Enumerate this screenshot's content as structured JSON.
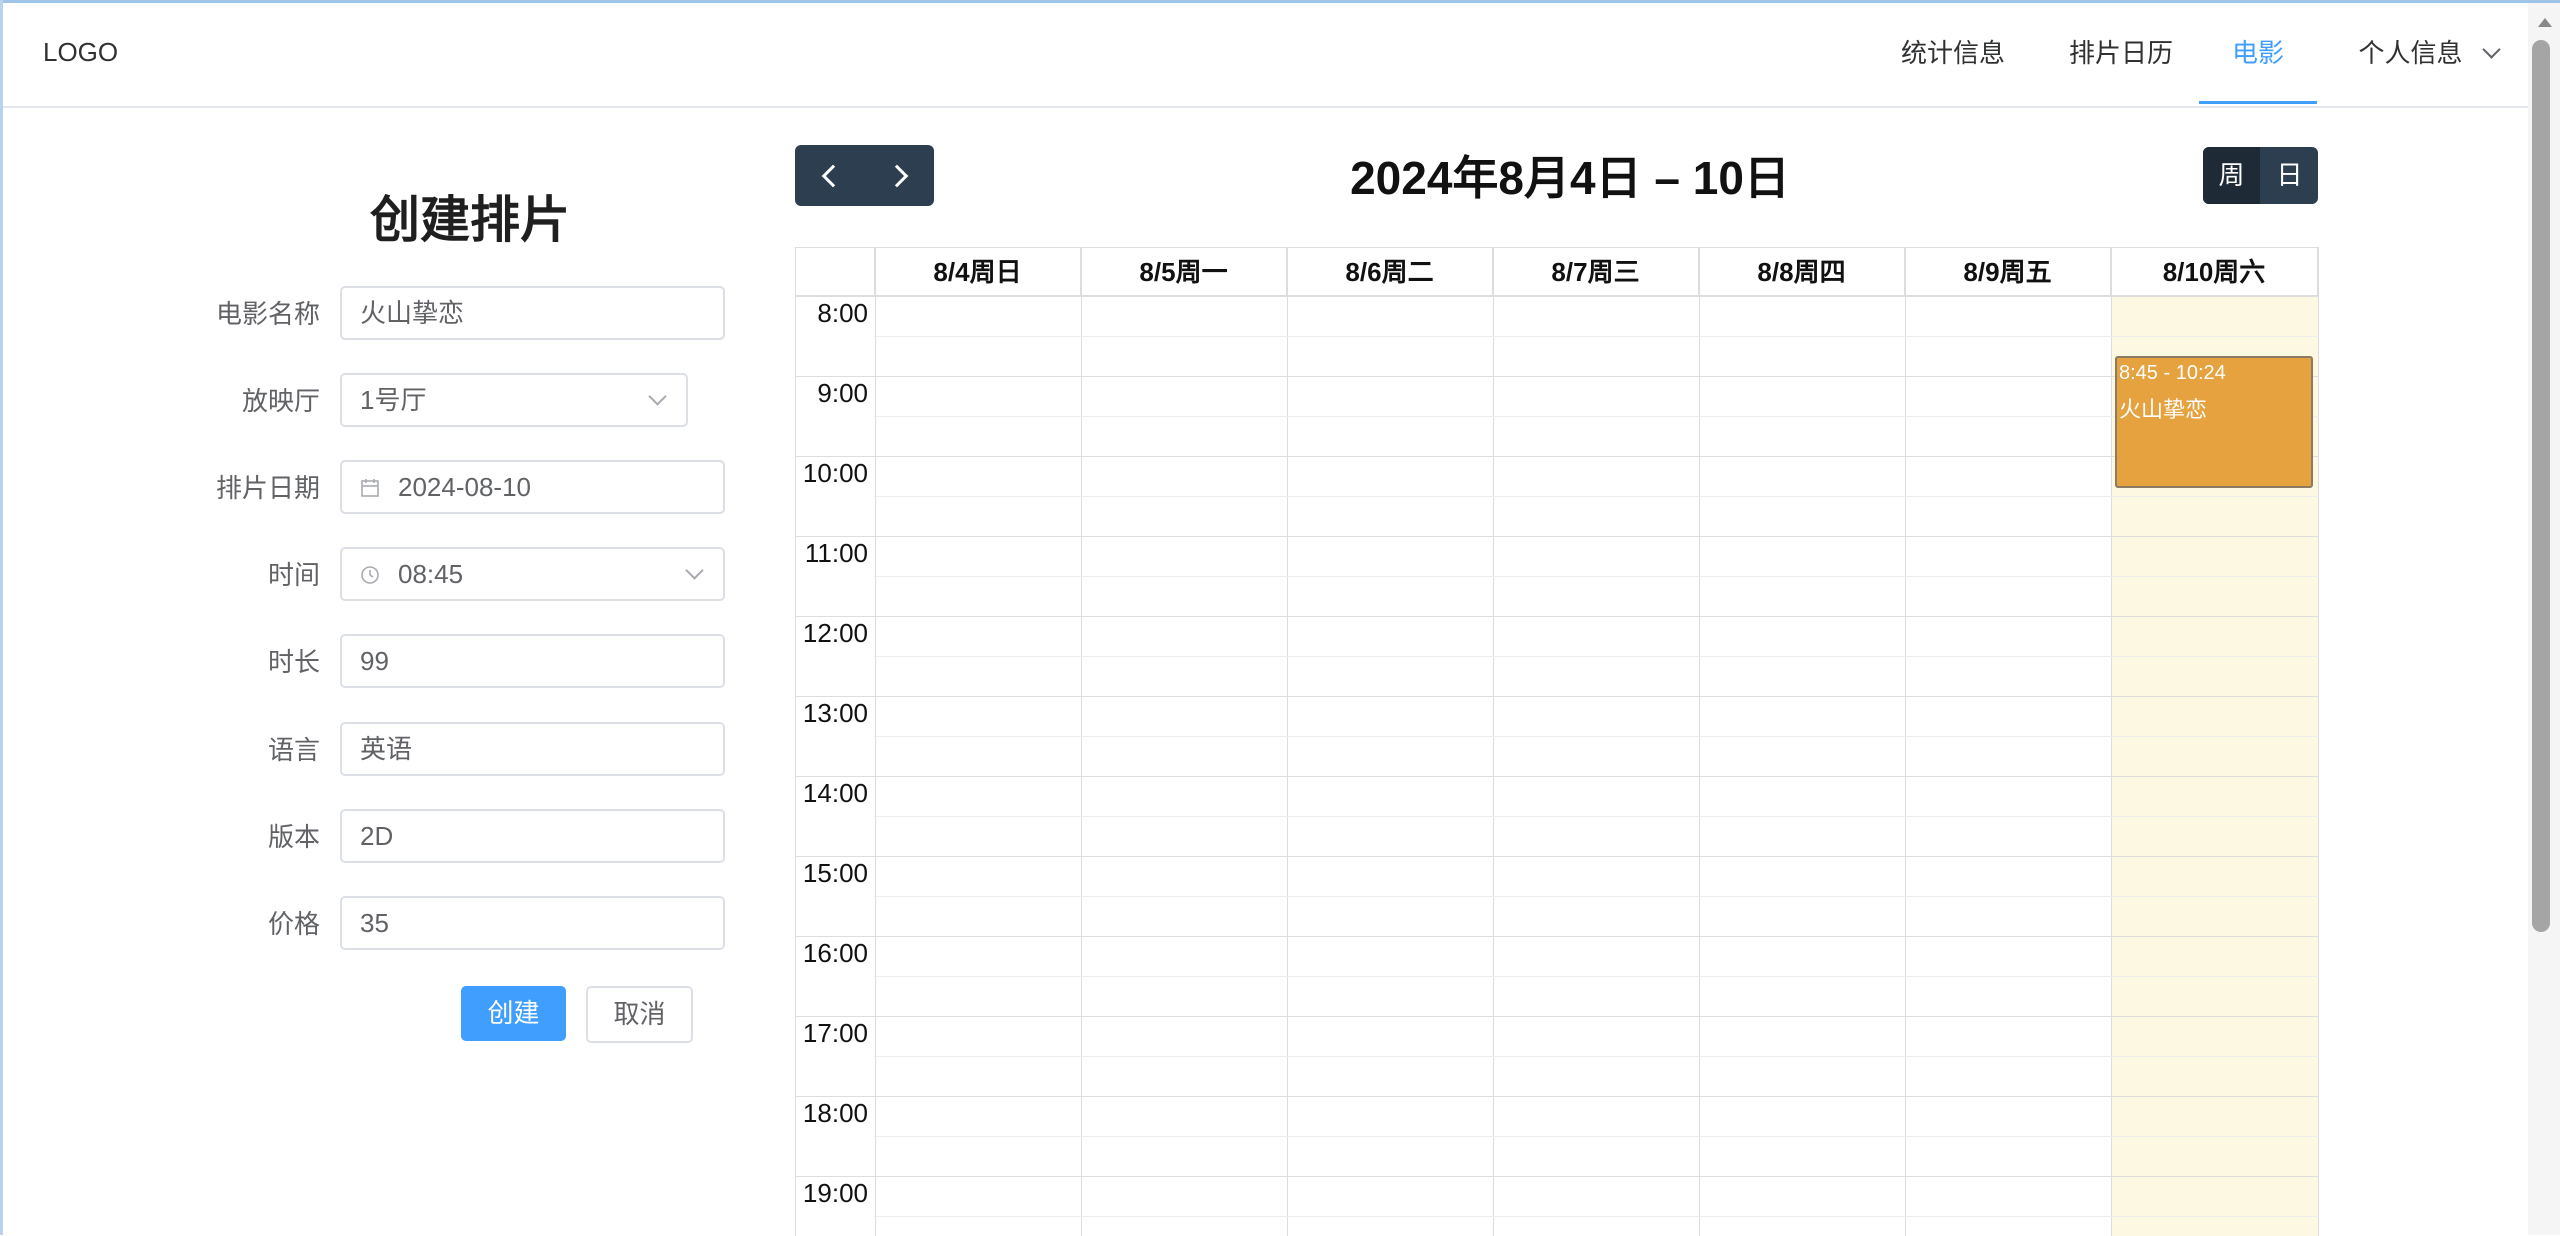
{
  "header": {
    "logo": "LOGO",
    "nav": [
      {
        "label": "统计信息",
        "active": false
      },
      {
        "label": "排片日历",
        "active": false
      },
      {
        "label": "电影",
        "active": true
      },
      {
        "label": "个人信息",
        "active": false,
        "dropdown": true
      }
    ]
  },
  "form": {
    "title": "创建排片",
    "fields": [
      {
        "label": "电影名称",
        "value": "火山挚恋",
        "type": "text"
      },
      {
        "label": "放映厅",
        "value": "1号厅",
        "type": "select"
      },
      {
        "label": "排片日期",
        "value": "2024-08-10",
        "type": "date",
        "icon": "calendar-icon"
      },
      {
        "label": "时间",
        "value": "08:45",
        "type": "time-select",
        "icon": "clock-icon"
      },
      {
        "label": "时长",
        "value": "99",
        "type": "text"
      },
      {
        "label": "语言",
        "value": "英语",
        "type": "text"
      },
      {
        "label": "版本",
        "value": "2D",
        "type": "text"
      },
      {
        "label": "价格",
        "value": "35",
        "type": "text"
      }
    ],
    "create_label": "创建",
    "cancel_label": "取消"
  },
  "calendar": {
    "title": "2024年8月4日 – 10日",
    "prev_icon": "chevron-left-icon",
    "next_icon": "chevron-right-icon",
    "views": [
      {
        "label": "周",
        "active": true
      },
      {
        "label": "日",
        "active": false
      }
    ],
    "days": [
      "8/4周日",
      "8/5周一",
      "8/6周二",
      "8/7周三",
      "8/8周四",
      "8/9周五",
      "8/10周六"
    ],
    "today_index": 6,
    "times": [
      "8:00",
      "9:00",
      "10:00",
      "11:00",
      "12:00",
      "13:00",
      "14:00",
      "15:00",
      "16:00",
      "17:00",
      "18:00",
      "19:00"
    ],
    "event": {
      "time": "8:45 - 10:24",
      "title": "火山挚恋",
      "day": "8/10周六",
      "color": "#e5a23e"
    }
  },
  "colors": {
    "primary": "#409eff",
    "dark_button": "#2c3e50",
    "today_bg": "#fdf8e1"
  }
}
